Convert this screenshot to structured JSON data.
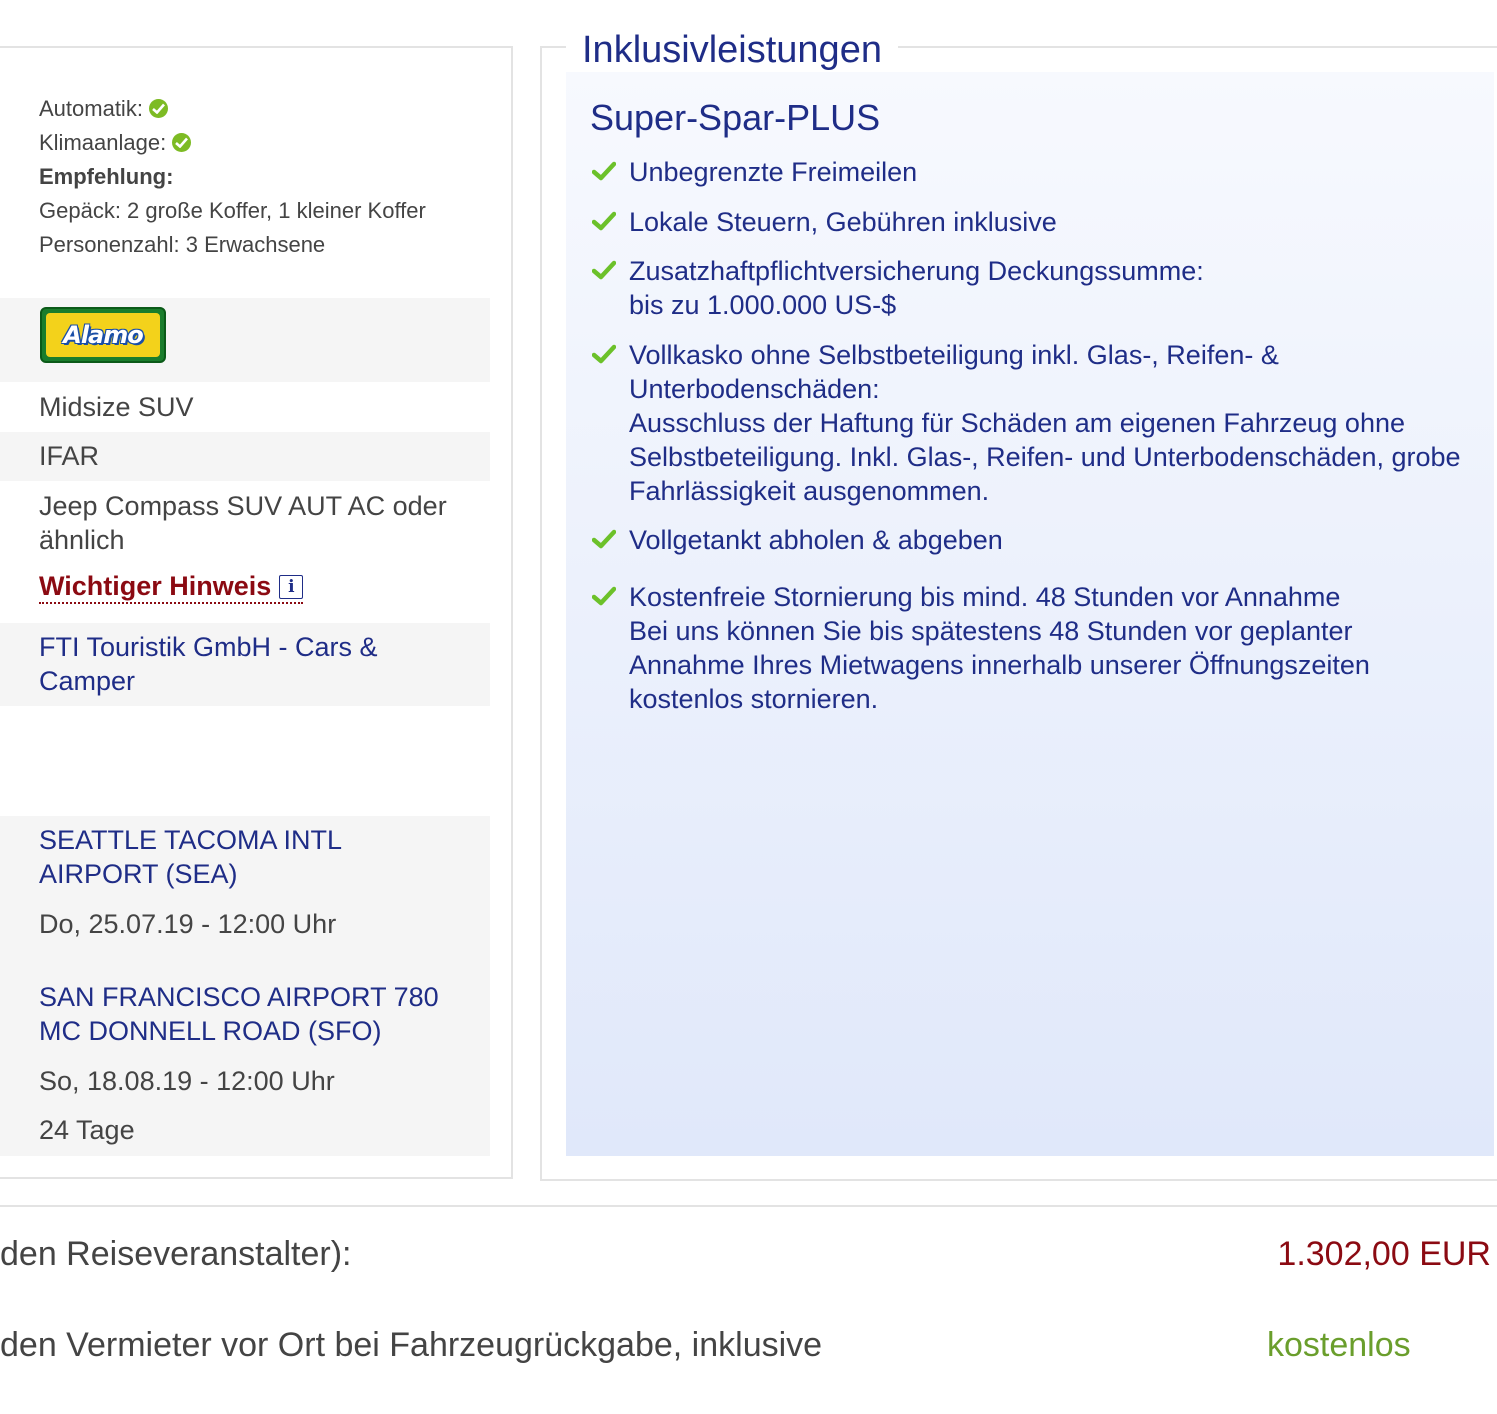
{
  "features": {
    "automatic_label": "Automatik:",
    "ac_label": "Klimaanlage:",
    "recommendation_heading": "Empfehlung:",
    "luggage": "Gepäck: 2 große Koffer, 1 kleiner Koffer",
    "passengers": "Personenzahl: 3 Erwachsene"
  },
  "vehicle": {
    "vendor_logo_text": "Alamo",
    "category": "Midsize SUV",
    "acriss_code": "IFAR",
    "model_line1": "Jeep Compass SUV AUT AC oder",
    "model_line2": "ähnlich",
    "notice_link": "Wichtiger Hinweis",
    "info_icon_glyph": "i"
  },
  "operator": {
    "line1": "FTI Touristik GmbH - Cars &",
    "line2": "Camper"
  },
  "pickup": {
    "location_line1": "SEATTLE TACOMA INTL",
    "location_line2": "AIRPORT (SEA)",
    "datetime": "Do, 25.07.19 - 12:00 Uhr"
  },
  "dropoff": {
    "location_line1": "SAN FRANCISCO AIRPORT 780",
    "location_line2": "MC DONNELL ROAD (SFO)",
    "datetime": "So, 18.08.19 - 12:00 Uhr"
  },
  "duration": "24 Tage",
  "inclusions": {
    "section_title": "Inklusivleistungen",
    "package_name": "Super-Spar-PLUS",
    "items": [
      {
        "lines": [
          "Unbegrenzte Freimeilen"
        ]
      },
      {
        "lines": [
          "Lokale Steuern, Gebühren inklusive"
        ]
      },
      {
        "lines": [
          "Zusatzhaftpflichtversicherung Deckungssumme:",
          "bis zu 1.000.000 US-$"
        ]
      },
      {
        "lines": [
          "Vollkasko ohne Selbstbeteiligung inkl. Glas-, Reifen- &",
          "Unterbodenschäden:",
          "Ausschluss der Haftung für Schäden am eigenen Fahrzeug ohne",
          "Selbstbeteiligung. Inkl. Glas-, Reifen- und Unterbodenschäden, grobe",
          "Fahrlässigkeit ausgenommen."
        ]
      },
      {
        "lines": [
          "Vollgetankt abholen & abgeben"
        ]
      },
      {
        "lines": [
          "Kostenfreie Stornierung bis mind. 48 Stunden vor Annahme",
          "Bei uns können Sie bis spätestens 48 Stunden vor geplanter",
          "Annahme Ihres Mietwagens innerhalb unserer Öffnungszeiten",
          "kostenlos stornieren."
        ]
      }
    ]
  },
  "totals": {
    "operator_label": "den Reiseveranstalter):",
    "operator_amount": "1.302,00 EUR",
    "onsite_label": "den Vermieter vor Ort bei Fahrzeugrückgabe, inklusive",
    "onsite_amount": "kostenlos"
  },
  "colors": {
    "heading_blue": "#1f2d87",
    "warning_red": "#8b0a12",
    "ok_green": "#7dbb24",
    "free_green": "#6a9e2c"
  },
  "icons": {
    "check": "checkmark-icon",
    "ok": "ok-circle-icon",
    "info": "info-icon"
  }
}
